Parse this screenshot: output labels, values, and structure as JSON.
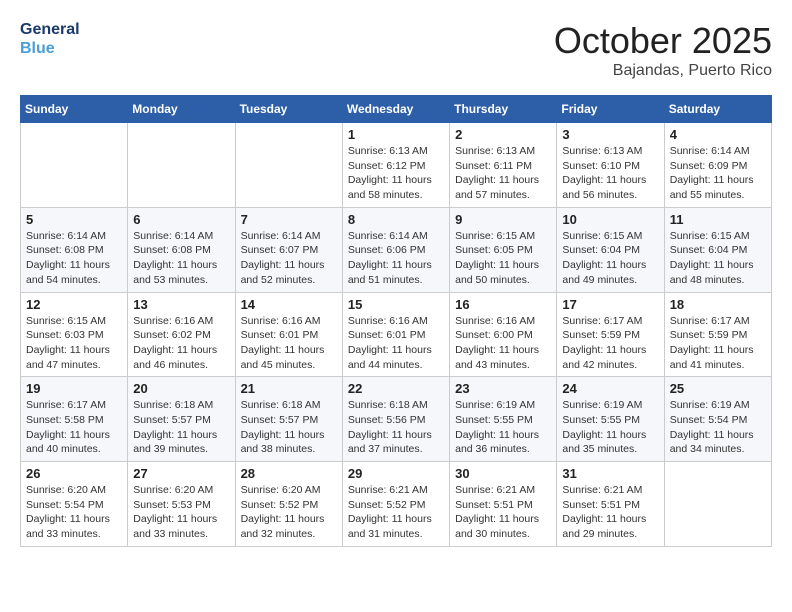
{
  "header": {
    "logo_line1": "General",
    "logo_line2": "Blue",
    "month": "October 2025",
    "location": "Bajandas, Puerto Rico"
  },
  "weekdays": [
    "Sunday",
    "Monday",
    "Tuesday",
    "Wednesday",
    "Thursday",
    "Friday",
    "Saturday"
  ],
  "weeks": [
    [
      {
        "day": "",
        "info": ""
      },
      {
        "day": "",
        "info": ""
      },
      {
        "day": "",
        "info": ""
      },
      {
        "day": "1",
        "info": "Sunrise: 6:13 AM\nSunset: 6:12 PM\nDaylight: 11 hours and 58 minutes."
      },
      {
        "day": "2",
        "info": "Sunrise: 6:13 AM\nSunset: 6:11 PM\nDaylight: 11 hours and 57 minutes."
      },
      {
        "day": "3",
        "info": "Sunrise: 6:13 AM\nSunset: 6:10 PM\nDaylight: 11 hours and 56 minutes."
      },
      {
        "day": "4",
        "info": "Sunrise: 6:14 AM\nSunset: 6:09 PM\nDaylight: 11 hours and 55 minutes."
      }
    ],
    [
      {
        "day": "5",
        "info": "Sunrise: 6:14 AM\nSunset: 6:08 PM\nDaylight: 11 hours and 54 minutes."
      },
      {
        "day": "6",
        "info": "Sunrise: 6:14 AM\nSunset: 6:08 PM\nDaylight: 11 hours and 53 minutes."
      },
      {
        "day": "7",
        "info": "Sunrise: 6:14 AM\nSunset: 6:07 PM\nDaylight: 11 hours and 52 minutes."
      },
      {
        "day": "8",
        "info": "Sunrise: 6:14 AM\nSunset: 6:06 PM\nDaylight: 11 hours and 51 minutes."
      },
      {
        "day": "9",
        "info": "Sunrise: 6:15 AM\nSunset: 6:05 PM\nDaylight: 11 hours and 50 minutes."
      },
      {
        "day": "10",
        "info": "Sunrise: 6:15 AM\nSunset: 6:04 PM\nDaylight: 11 hours and 49 minutes."
      },
      {
        "day": "11",
        "info": "Sunrise: 6:15 AM\nSunset: 6:04 PM\nDaylight: 11 hours and 48 minutes."
      }
    ],
    [
      {
        "day": "12",
        "info": "Sunrise: 6:15 AM\nSunset: 6:03 PM\nDaylight: 11 hours and 47 minutes."
      },
      {
        "day": "13",
        "info": "Sunrise: 6:16 AM\nSunset: 6:02 PM\nDaylight: 11 hours and 46 minutes."
      },
      {
        "day": "14",
        "info": "Sunrise: 6:16 AM\nSunset: 6:01 PM\nDaylight: 11 hours and 45 minutes."
      },
      {
        "day": "15",
        "info": "Sunrise: 6:16 AM\nSunset: 6:01 PM\nDaylight: 11 hours and 44 minutes."
      },
      {
        "day": "16",
        "info": "Sunrise: 6:16 AM\nSunset: 6:00 PM\nDaylight: 11 hours and 43 minutes."
      },
      {
        "day": "17",
        "info": "Sunrise: 6:17 AM\nSunset: 5:59 PM\nDaylight: 11 hours and 42 minutes."
      },
      {
        "day": "18",
        "info": "Sunrise: 6:17 AM\nSunset: 5:59 PM\nDaylight: 11 hours and 41 minutes."
      }
    ],
    [
      {
        "day": "19",
        "info": "Sunrise: 6:17 AM\nSunset: 5:58 PM\nDaylight: 11 hours and 40 minutes."
      },
      {
        "day": "20",
        "info": "Sunrise: 6:18 AM\nSunset: 5:57 PM\nDaylight: 11 hours and 39 minutes."
      },
      {
        "day": "21",
        "info": "Sunrise: 6:18 AM\nSunset: 5:57 PM\nDaylight: 11 hours and 38 minutes."
      },
      {
        "day": "22",
        "info": "Sunrise: 6:18 AM\nSunset: 5:56 PM\nDaylight: 11 hours and 37 minutes."
      },
      {
        "day": "23",
        "info": "Sunrise: 6:19 AM\nSunset: 5:55 PM\nDaylight: 11 hours and 36 minutes."
      },
      {
        "day": "24",
        "info": "Sunrise: 6:19 AM\nSunset: 5:55 PM\nDaylight: 11 hours and 35 minutes."
      },
      {
        "day": "25",
        "info": "Sunrise: 6:19 AM\nSunset: 5:54 PM\nDaylight: 11 hours and 34 minutes."
      }
    ],
    [
      {
        "day": "26",
        "info": "Sunrise: 6:20 AM\nSunset: 5:54 PM\nDaylight: 11 hours and 33 minutes."
      },
      {
        "day": "27",
        "info": "Sunrise: 6:20 AM\nSunset: 5:53 PM\nDaylight: 11 hours and 33 minutes."
      },
      {
        "day": "28",
        "info": "Sunrise: 6:20 AM\nSunset: 5:52 PM\nDaylight: 11 hours and 32 minutes."
      },
      {
        "day": "29",
        "info": "Sunrise: 6:21 AM\nSunset: 5:52 PM\nDaylight: 11 hours and 31 minutes."
      },
      {
        "day": "30",
        "info": "Sunrise: 6:21 AM\nSunset: 5:51 PM\nDaylight: 11 hours and 30 minutes."
      },
      {
        "day": "31",
        "info": "Sunrise: 6:21 AM\nSunset: 5:51 PM\nDaylight: 11 hours and 29 minutes."
      },
      {
        "day": "",
        "info": ""
      }
    ]
  ]
}
